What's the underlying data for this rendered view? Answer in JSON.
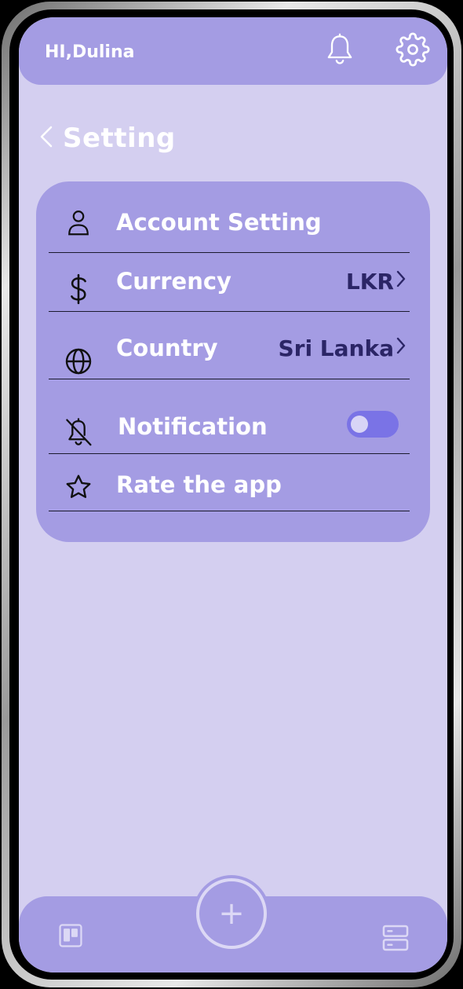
{
  "header": {
    "greeting": "HI,Dulina",
    "icons": [
      "bell-icon",
      "gear-icon"
    ]
  },
  "page": {
    "title": "Setting",
    "back_icon": "chevron-left-icon"
  },
  "settings": {
    "items": [
      {
        "label": "Account Setting",
        "icon": "user-icon"
      },
      {
        "label": "Currency",
        "icon": "dollar-icon",
        "value": "LKR"
      },
      {
        "label": "Country",
        "icon": "globe-icon",
        "value": "Sri Lanka"
      },
      {
        "label": "Notification",
        "icon": "bell-off-icon",
        "toggle_on": false
      },
      {
        "label": "Rate the app",
        "icon": "star-icon"
      }
    ]
  },
  "bottom_nav": {
    "left_icon": "board-icon",
    "center_icon": "plus-icon",
    "center_symbol": "+",
    "right_icon": "server-icon"
  },
  "colors": {
    "background": "#d4cff0",
    "bar": "#a49ce3",
    "accent": "#7a73e6",
    "value_text": "#2b2566"
  }
}
